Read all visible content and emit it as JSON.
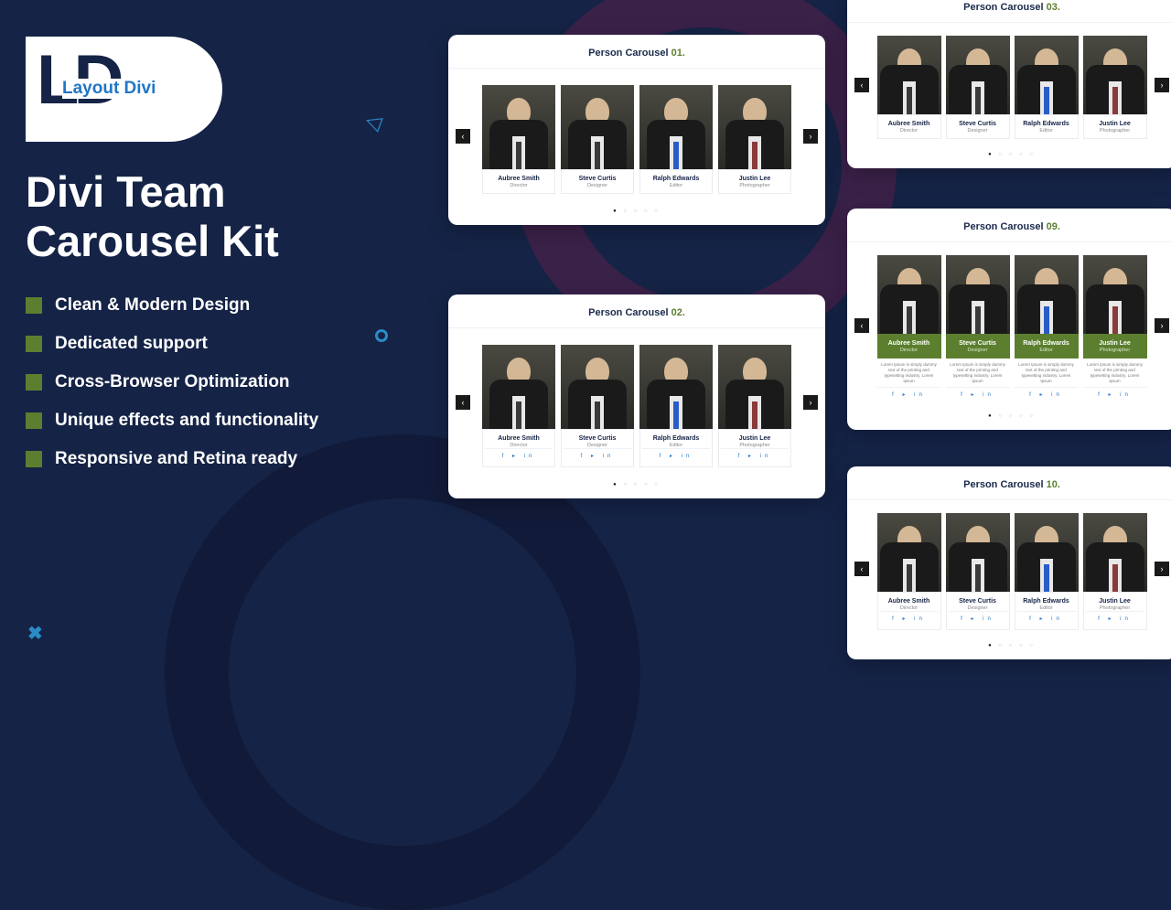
{
  "logo": {
    "initials": "LD",
    "text": "Layout Divi"
  },
  "title_line1": "Divi Team",
  "title_line2": "Carousel Kit",
  "features": [
    "Clean & Modern Design",
    "Dedicated support",
    "Cross-Browser Optimization",
    "Unique effects and functionality",
    "Responsive and Retina ready"
  ],
  "people": [
    {
      "name": "Aubree Smith",
      "role": "Director",
      "tie": "dark"
    },
    {
      "name": "Steve Curtis",
      "role": "Designer",
      "tie": "dark"
    },
    {
      "name": "Ralph Edwards",
      "role": "Editor",
      "tie": "blue"
    },
    {
      "name": "Justin Lee",
      "role": "Photographer",
      "tie": "red"
    }
  ],
  "desc": "Lorem Ipsum is simply dummy text of the printing and typesetting industry. Lorem Ipsum",
  "previews": {
    "p1": {
      "label": "Person Carousel ",
      "num": "01.",
      "style": "plain"
    },
    "p2": {
      "label": "Person Carousel ",
      "num": "02.",
      "style": "socials"
    },
    "p3": {
      "label": "Person Carousel ",
      "num": "03.",
      "style": "plain"
    },
    "p9": {
      "label": "Person Carousel ",
      "num": "09.",
      "style": "green"
    },
    "p10": {
      "label": "Person Carousel ",
      "num": "10.",
      "style": "socials"
    }
  },
  "socials_glyphs": "f ▸ in",
  "nav": {
    "prev": "‹",
    "next": "›"
  }
}
